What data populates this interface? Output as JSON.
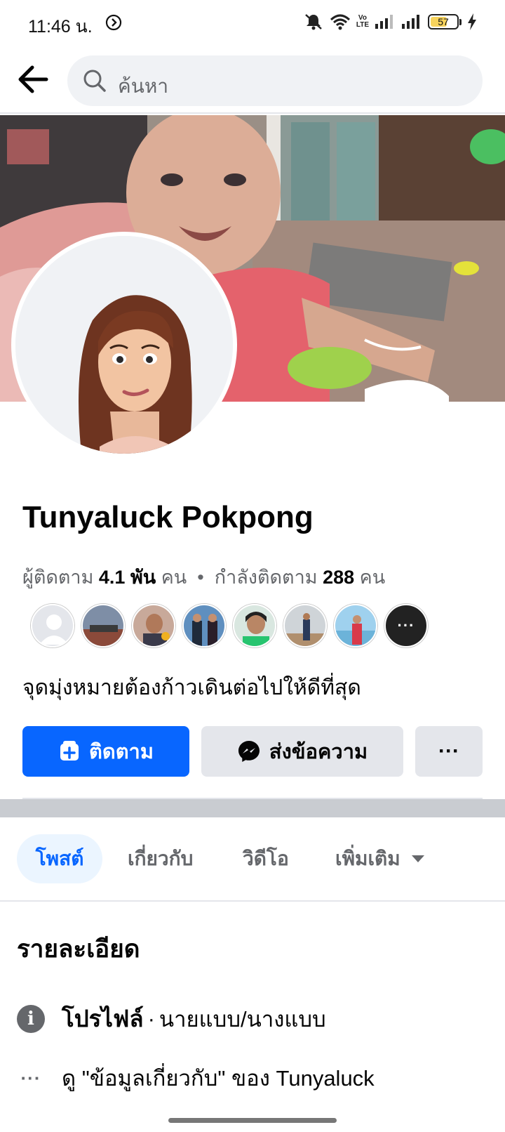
{
  "status_bar": {
    "time": "11:46 น.",
    "battery": "57",
    "network_label_1": "Vo",
    "network_label_2": "LTE"
  },
  "search": {
    "placeholder": "ค้นหา"
  },
  "profile": {
    "name": "Tunyaluck Pokpong",
    "followers_label": "ผู้ติดตาม",
    "followers_count": "4.1 พัน",
    "followers_unit": "คน",
    "separator": "•",
    "following_label": "กำลังติดตาม",
    "following_count": "288",
    "following_unit": "คน",
    "bio": "จุดมุ่งหมายต้องก้าวเดินต่อไปให้ดีที่สุด"
  },
  "actions": {
    "follow_label": "ติดตาม",
    "message_label": "ส่งข้อความ",
    "more_label": "···"
  },
  "tabs": [
    {
      "label": "โพสต์",
      "active": true
    },
    {
      "label": "เกี่ยวกับ",
      "active": false
    },
    {
      "label": "วิดีโอ",
      "active": false
    },
    {
      "label": "เพิ่มเติม",
      "active": false
    }
  ],
  "details": {
    "title": "รายละเอียด",
    "profile_label": "โปรไฟล์",
    "profile_dot": "·",
    "profile_value": "นายแบบ/นางแบบ",
    "about_link": "ดู \"ข้อมูลเกี่ยวกับ\" ของ Tunyaluck"
  },
  "colors": {
    "primary": "#0866ff",
    "secondary_bg": "#e4e6eb",
    "muted_text": "#65676b"
  }
}
